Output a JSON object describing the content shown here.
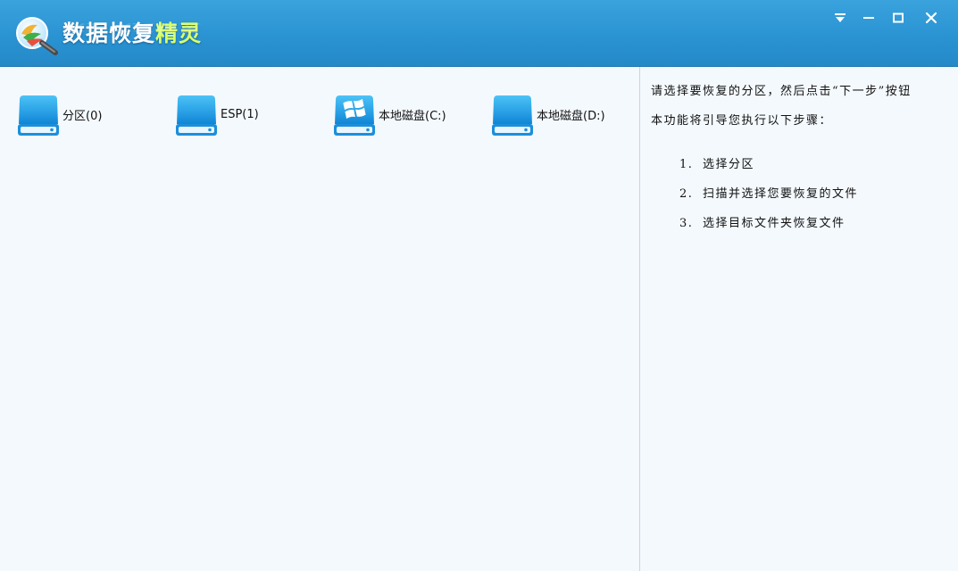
{
  "app": {
    "title_main": "数据恢复",
    "title_accent": "精灵"
  },
  "window_controls": {
    "menu": "menu-icon",
    "minimize": "minimize-icon",
    "maximize": "maximize-icon",
    "close": "close-icon"
  },
  "partitions": [
    {
      "label": "分区(0)",
      "icon": "drive-icon"
    },
    {
      "label": "ESP(1)",
      "icon": "drive-icon"
    },
    {
      "label": "本地磁盘(C:)",
      "icon": "windows-drive-icon"
    },
    {
      "label": "本地磁盘(D:)",
      "icon": "drive-icon"
    }
  ],
  "info": {
    "line1": "请选择要恢复的分区，然后点击“下一步”按钮",
    "line2": "本功能将引导您执行以下步骤：",
    "steps": [
      {
        "num": "1.",
        "text": "选择分区"
      },
      {
        "num": "2.",
        "text": "扫描并选择您要恢复的文件"
      },
      {
        "num": "3.",
        "text": "选择目标文件夹恢复文件"
      }
    ]
  },
  "colors": {
    "titlebar": "#2a93d2",
    "accent": "#d8ff6a",
    "drive_blue": "#1f9be0",
    "background": "#f4f9fd"
  }
}
